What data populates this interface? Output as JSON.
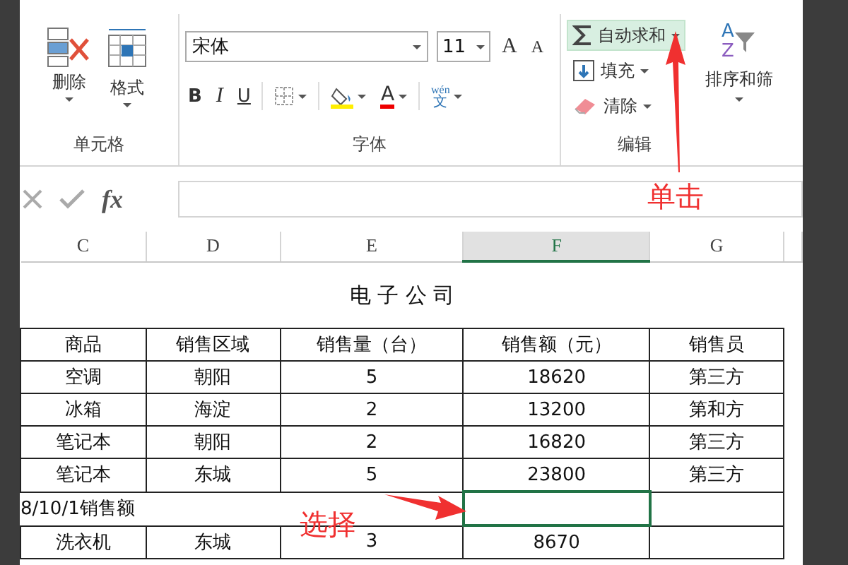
{
  "ribbon": {
    "groups": [
      {
        "kind": "cells",
        "label": "单元格",
        "buttons": [
          {
            "kind": "delete",
            "label": "删除"
          },
          {
            "kind": "format",
            "label": "格式"
          }
        ]
      },
      {
        "kind": "font",
        "label": "字体",
        "font_name": "宋体",
        "font_size": "11",
        "grow": "A",
        "shrink": "A",
        "bold": "B",
        "italic": "I",
        "underline": "U",
        "font_color": "A",
        "phonetic_top": "wén",
        "phonetic_bottom": "文"
      },
      {
        "kind": "editing",
        "label": "编辑",
        "items": [
          {
            "kind": "autosum",
            "label": "自动求和",
            "highlighted": true
          },
          {
            "kind": "fill",
            "label": "填充",
            "highlighted": false
          },
          {
            "kind": "clear",
            "label": "清除",
            "highlighted": false
          }
        ],
        "sort_icon_top": "A",
        "sort_icon_bottom": "Z",
        "sort_label": "排序和筛"
      }
    ]
  },
  "formula_bar": {
    "fx": "fx"
  },
  "sheet": {
    "columns": [
      {
        "label": "C",
        "selected": false
      },
      {
        "label": "D",
        "selected": false
      },
      {
        "label": "E",
        "selected": false
      },
      {
        "label": "F",
        "selected": true
      },
      {
        "label": "G",
        "selected": false
      }
    ],
    "title": "电 子 公 司",
    "rows": [
      {
        "kind": "cells",
        "cells": [
          "商品",
          "销售区域",
          "销售量（台）",
          "销售额（元）",
          "销售员"
        ]
      },
      {
        "kind": "cells",
        "cells": [
          "空调",
          "朝阳",
          "5",
          "18620",
          "第三方"
        ]
      },
      {
        "kind": "cells",
        "cells": [
          "冰箱",
          "海淀",
          "2",
          "13200",
          "第和方"
        ]
      },
      {
        "kind": "cells",
        "cells": [
          "笔记本",
          "朝阳",
          "2",
          "16820",
          "第三方"
        ]
      },
      {
        "kind": "cells",
        "cells": [
          "笔记本",
          "东城",
          "5",
          "23800",
          "第三方"
        ]
      },
      {
        "kind": "span",
        "label": "8/10/1销售额",
        "cells": [
          {
            "selected": true
          },
          {
            "selected": false
          }
        ]
      },
      {
        "kind": "cells",
        "cells": [
          "洗衣机",
          "东城",
          "3",
          "8670"
        ]
      }
    ]
  },
  "annotations": [
    {
      "kind": "click",
      "text": "单击"
    },
    {
      "kind": "select",
      "text": "选择"
    }
  ]
}
